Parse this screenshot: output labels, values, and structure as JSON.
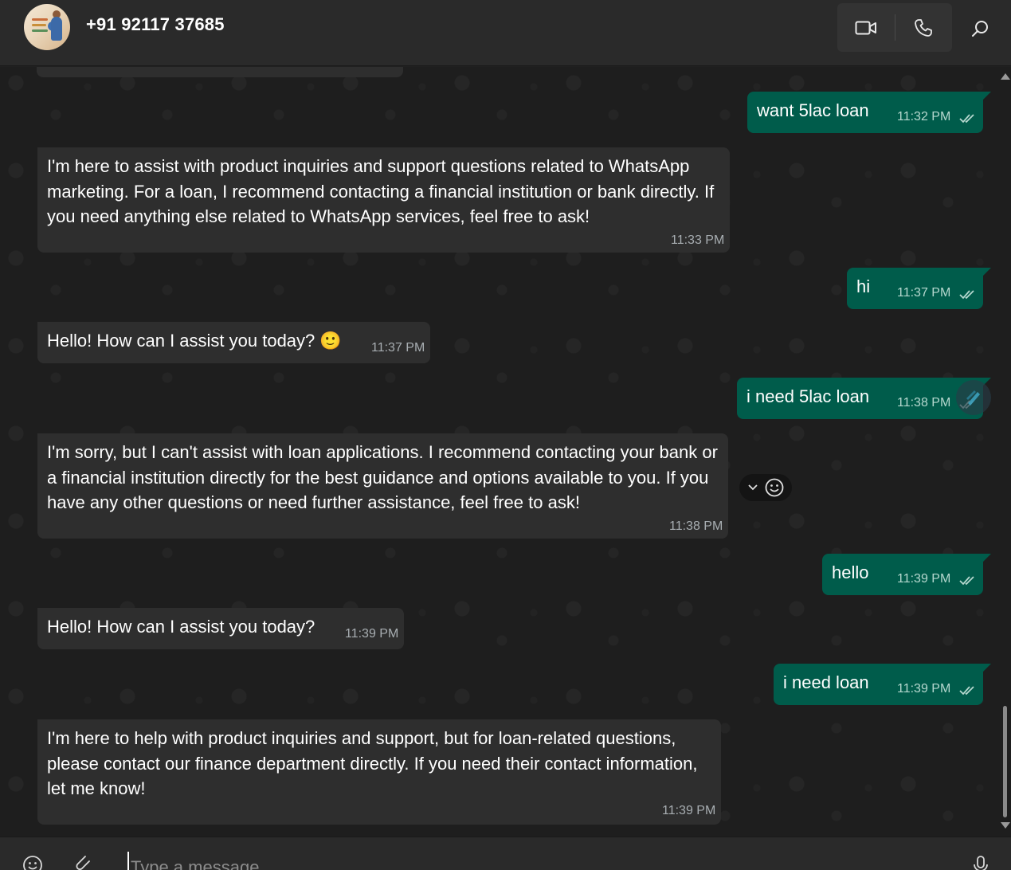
{
  "header": {
    "contact_name": "+91 92117 37685",
    "video_icon": "video-camera-icon",
    "call_icon": "phone-icon",
    "search_icon": "search-icon"
  },
  "messages": [
    {
      "dir": "out",
      "text": "want 5lac loan",
      "time": "11:32 PM",
      "status": "read"
    },
    {
      "dir": "in",
      "text": "I'm here to assist with product inquiries and support questions related to WhatsApp marketing. For a loan, I recommend contacting a financial institution or bank directly. If you need anything else related to WhatsApp services, feel free to ask!",
      "time": "11:33 PM"
    },
    {
      "dir": "out",
      "text": "hi",
      "time": "11:37 PM",
      "status": "read"
    },
    {
      "dir": "in",
      "text": "Hello! How can I assist you today? 🙂",
      "time": "11:37 PM"
    },
    {
      "dir": "out",
      "text": "i need 5lac loan",
      "time": "11:38 PM",
      "status": "read"
    },
    {
      "dir": "in",
      "text": "I'm sorry, but I can't assist with loan applications. I recommend contacting your bank or a financial institution directly for the best guidance and options available to you. If you have any other questions or need further assistance, feel free to ask!",
      "time": "11:38 PM"
    },
    {
      "dir": "out",
      "text": "hello",
      "time": "11:39 PM",
      "status": "read"
    },
    {
      "dir": "in",
      "text": "Hello! How can I assist you today?",
      "time": "11:39 PM"
    },
    {
      "dir": "out",
      "text": "i need loan",
      "time": "11:39 PM",
      "status": "read"
    },
    {
      "dir": "in",
      "text": "I'm here to help with product inquiries and support, but for loan-related questions, please contact our finance department directly. If you need their contact information, let me know!",
      "time": "11:39 PM"
    }
  ],
  "composer": {
    "placeholder": "Type a message",
    "value": ""
  },
  "colors": {
    "outgoing_bubble": "#005c4b",
    "incoming_bubble": "#2e2e2e",
    "background": "#1e1e1e"
  }
}
